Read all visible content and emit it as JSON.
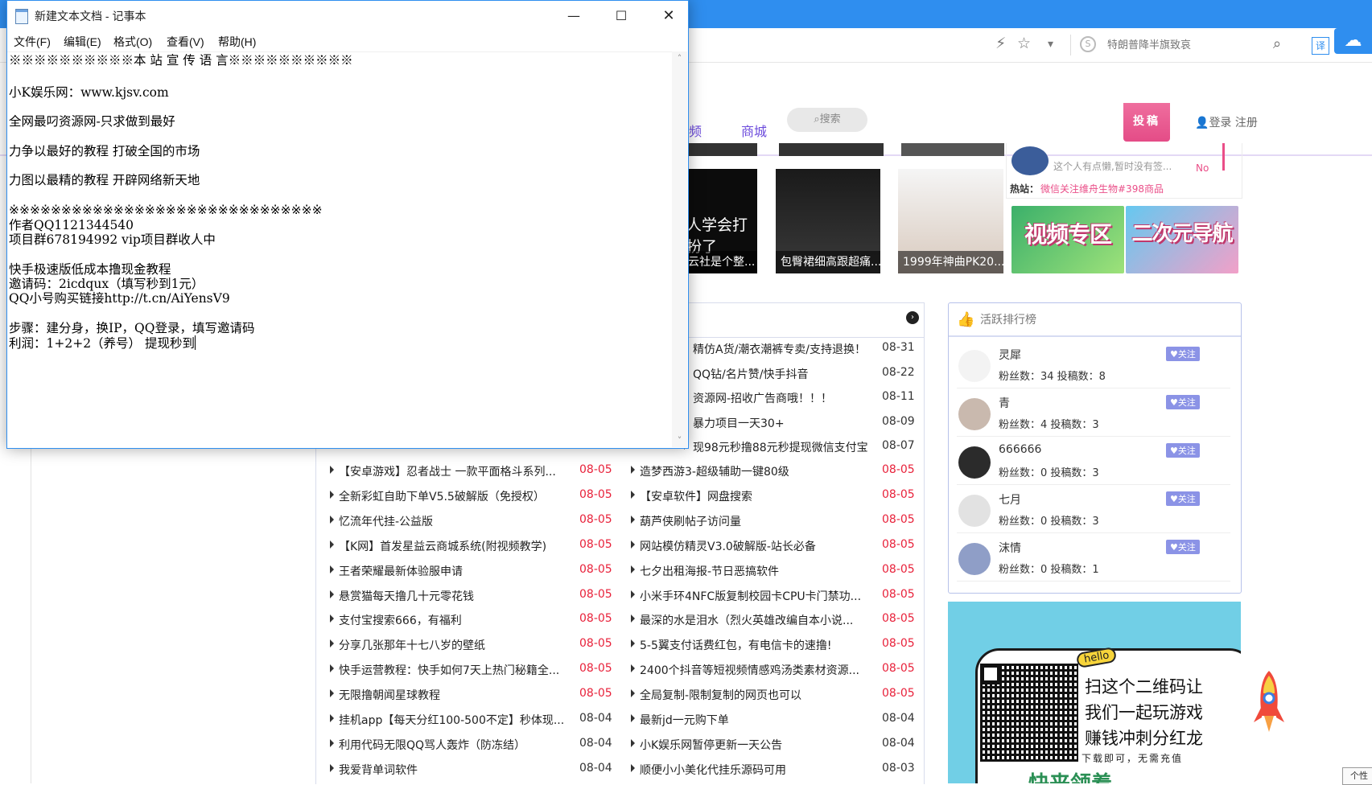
{
  "notepad": {
    "title": "新建文本文档 - 记事本",
    "controls": {
      "minimize": "—",
      "maximize": "☐",
      "close": "✕"
    },
    "menu": [
      "文件(F)",
      "编辑(E)",
      "格式(O)",
      "查看(V)",
      "帮助(H)"
    ],
    "lines": [
      "※※※※※※※※※※本 站 宣 传 语 言※※※※※※※※※※",
      "",
      "小K娱乐网：www.kjsv.com",
      "",
      "全网最叼资源网-只求做到最好",
      "",
      "力争以最好的教程 打破全国的市场",
      "",
      "力图以最精的教程 开辟网络新天地",
      "",
      "※※※※※※※※※※※※※※※※※※※※※※※※※※※※※※",
      "作者QQ1121344540",
      "项目群678194992 vip项目群收人中",
      "",
      "快手极速版低成本撸现金教程",
      "邀请码：2icdqux（填写秒到1元）",
      "QQ小号购买链接http://t.cn/AiYensV9",
      "",
      "步骤：建分身，换IP，QQ登录，填写邀请码",
      "利润：1+2+2（养号） 提现秒到"
    ]
  },
  "browser": {
    "search_placeholder": "特朗普降半旗致哀",
    "icons": {
      "bolt": "⚡",
      "star": "☆",
      "dropdown": "▾",
      "search": "⌕",
      "translate": "译",
      "cloud": "☁"
    }
  },
  "site": {
    "nav": {
      "video_partial": "频",
      "mall": "商城",
      "search": "搜索",
      "submit": "投稿",
      "login": "登录 注册"
    },
    "hot": {
      "quote": "这个人有点懒,暂时没有签...",
      "no": "No",
      "label": "热站：",
      "text": "微信关注维舟生物#398商品"
    },
    "thumbs": [
      {
        "big": "人学会打扮了",
        "cap": "云社是个整..."
      },
      {
        "big": "",
        "cap": "包臀裙细高跟超痛..."
      },
      {
        "big": "",
        "cap": "1999年神曲PK20..."
      }
    ],
    "banners": [
      "视频专区",
      "二次元导航"
    ],
    "articles_right_top": [
      {
        "title": "精仿A货/潮衣潮裤专卖/支持退换！",
        "date": "08-31"
      },
      {
        "title": "QQ钻/名片赞/快手抖音",
        "date": "08-22"
      },
      {
        "title": "资源网-招收广告商哦！！！",
        "date": "08-11"
      },
      {
        "title": "暴力项目一天30+",
        "date": "08-09"
      },
      {
        "title": "现98元秒撸88元秒提现微信支付宝",
        "date": "08-07"
      }
    ],
    "articles_left": [
      {
        "title": "【安卓游戏】忍者战士 一款平面格斗系列...",
        "date": "08-05"
      },
      {
        "title": "全新彩虹自助下单V5.5破解版（免授权）",
        "date": "08-05"
      },
      {
        "title": "忆流年代挂-公益版",
        "date": "08-05"
      },
      {
        "title": "【K网】首发星益云商城系统(附视频教学)",
        "date": "08-05"
      },
      {
        "title": "王者荣耀最新体验服申请",
        "date": "08-05"
      },
      {
        "title": "悬赏猫每天撸几十元零花钱",
        "date": "08-05"
      },
      {
        "title": "支付宝搜索666，有福利",
        "date": "08-05"
      },
      {
        "title": "分享几张那年十七八岁的壁纸",
        "date": "08-05"
      },
      {
        "title": "快手运营教程：快手如何7天上热门秘籍全...",
        "date": "08-05"
      },
      {
        "title": "无限撸朝闻星球教程",
        "date": "08-05"
      },
      {
        "title": "挂机app【每天分红100-500不定】秒体现...",
        "date": "08-04"
      },
      {
        "title": "利用代码无限QQ骂人轰炸（防冻结）",
        "date": "08-04"
      },
      {
        "title": "我爱背单词软件",
        "date": "08-04"
      }
    ],
    "articles_right": [
      {
        "title": "造梦西游3-超级辅助一键80级",
        "date": "08-05"
      },
      {
        "title": "【安卓软件】网盘搜索",
        "date": "08-05"
      },
      {
        "title": "葫芦侠刷帖子访问量",
        "date": "08-05"
      },
      {
        "title": "网站模仿精灵V3.0破解版-站长必备",
        "date": "08-05"
      },
      {
        "title": "七夕出租海报-节日恶搞软件",
        "date": "08-05"
      },
      {
        "title": "小米手环4NFC版复制校园卡CPU卡门禁功...",
        "date": "08-05"
      },
      {
        "title": "最深的水是泪水（烈火英雄改编自本小说...",
        "date": "08-05"
      },
      {
        "title": "5-5翼支付话费红包，有电信卡的速撸!",
        "date": "08-05"
      },
      {
        "title": "2400个抖音等短视频情感鸡汤类素材资源...",
        "date": "08-05"
      },
      {
        "title": "全局复制-限制复制的网页也可以",
        "date": "08-05"
      },
      {
        "title": "最新jd一元购下单",
        "date": "08-04"
      },
      {
        "title": "小K娱乐网暂停更新一天公告",
        "date": "08-04"
      },
      {
        "title": "顺便小小美化代挂乐源码可用",
        "date": "08-03"
      }
    ],
    "rank": {
      "title": "活跃排行榜",
      "follow_label": "♥关注",
      "users": [
        {
          "name": "灵犀",
          "stats": "粉丝数：34 投稿数：8"
        },
        {
          "name": "青",
          "stats": "粉丝数：4 投稿数：3"
        },
        {
          "name": "666666",
          "stats": "粉丝数：0 投稿数：3"
        },
        {
          "name": "七月",
          "stats": "粉丝数：0 投稿数：3"
        },
        {
          "name": "沫情",
          "stats": "粉丝数：0 投稿数：1"
        }
      ]
    },
    "qr": {
      "hello": "hello",
      "line1": "扫这个二维码让",
      "line2": "我们一起玩游戏",
      "line3": "赚钱冲刺分红龙",
      "line4": "下载即可，无需充值",
      "footer": "快来领着"
    },
    "corner_tab": "个性"
  },
  "colors": {
    "accent": "#2f8eef",
    "pink": "#ea4e88",
    "date_red": "#e8213a",
    "purple": "#6c4bdc"
  }
}
